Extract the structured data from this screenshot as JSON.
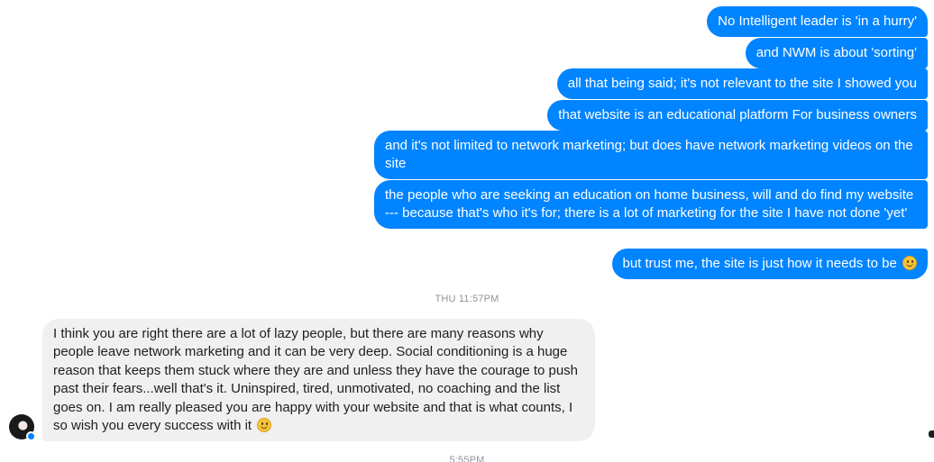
{
  "conversation": {
    "outgoing": [
      "No Intelligent leader is 'in a hurry'",
      "and NWM is about 'sorting'",
      "all that being said; it's not relevant to the site I showed you",
      "that website is an educational platform For business owners",
      "and it's not limited to network marketing; but does have network marketing videos on the site",
      "the people who are seeking an education on home business, will and do find my website --- because that's who it's for; there is a lot of marketing for the site I have not done 'yet'",
      "but trust me, the site is just how it needs to be"
    ],
    "timestamp": "THU 11:57PM",
    "incoming": {
      "text": "I think you are right there are a lot of lazy people, but there are many reasons why people leave network marketing and it can be very deep.  Social conditioning is a huge reason that keeps them stuck where they are and unless they have the courage to push past their fears...well that's it. Uninspired, tired, unmotivated, no coaching and the list goes on.  I am really pleased you are happy with your website and that is what counts, I so wish you every success with it"
    },
    "next_timestamp": "5:55PM"
  },
  "icons": {
    "emoji": "slightly-smiling-face-icon",
    "avatar": "contact-avatar",
    "badge": "messenger-badge-icon"
  },
  "colors": {
    "outgoing_bubble": "#0084ff",
    "incoming_bubble": "#f1f0f0",
    "timestamp": "#90949c"
  }
}
